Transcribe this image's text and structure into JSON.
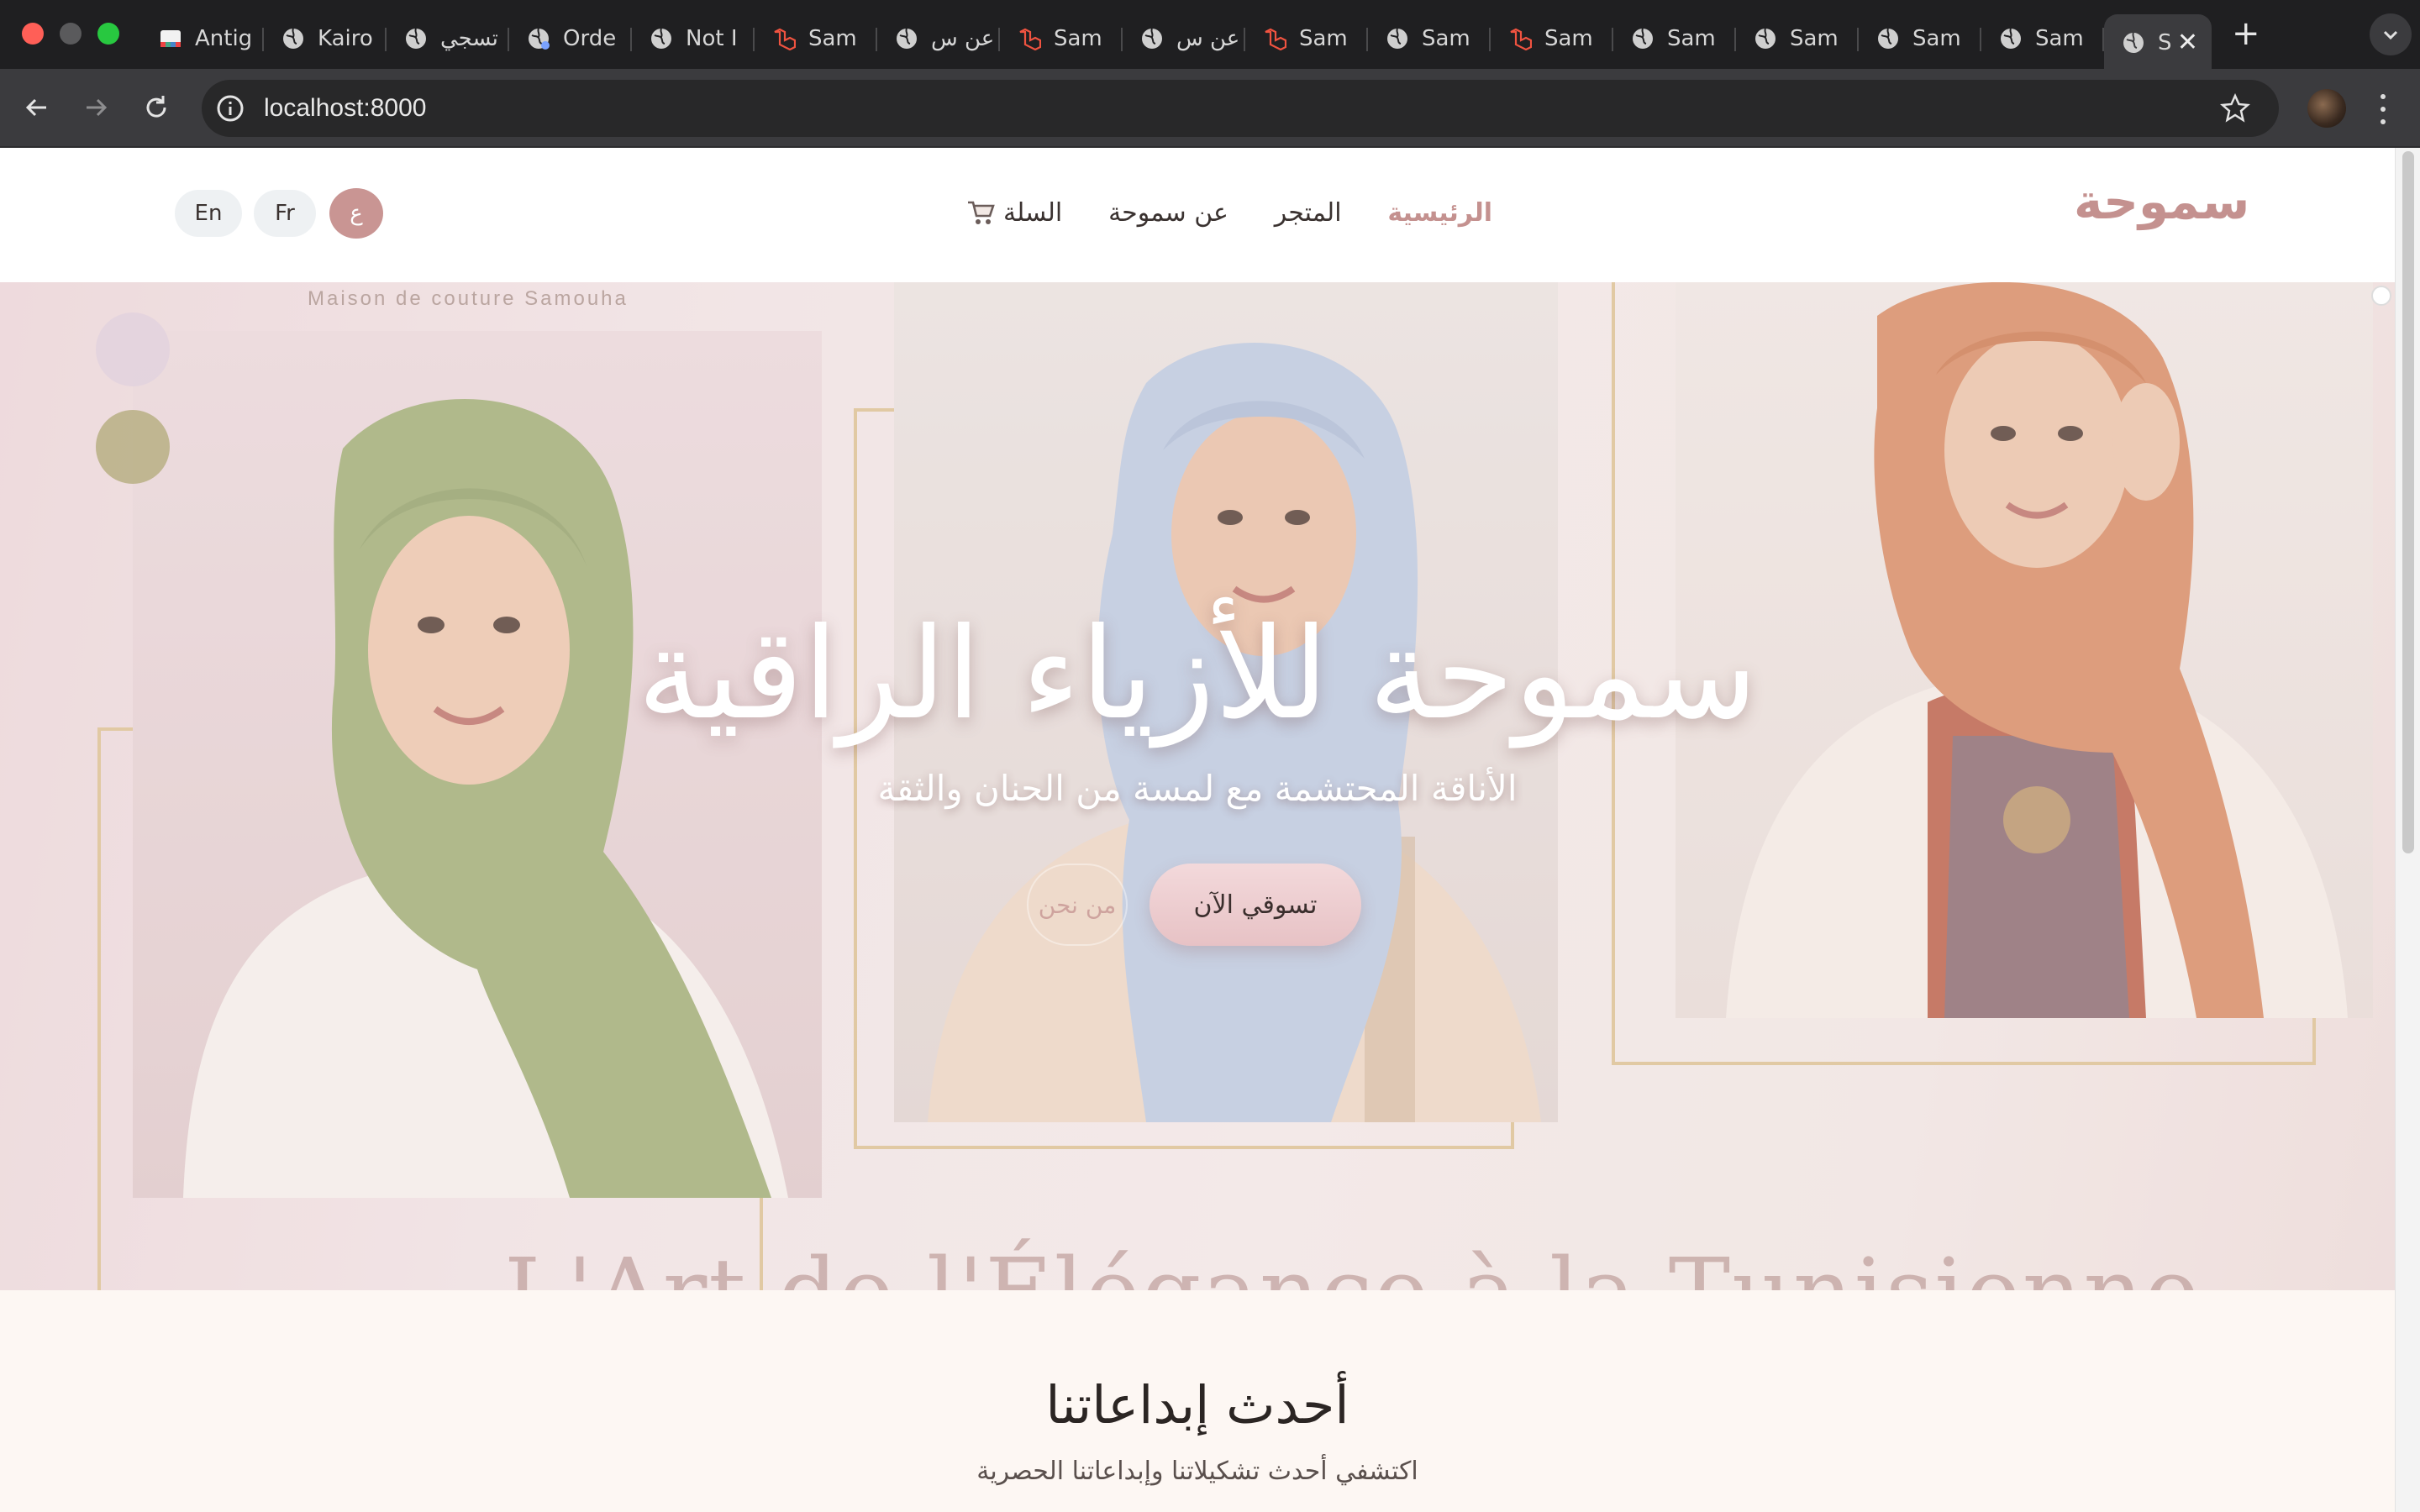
{
  "browser": {
    "tabs": [
      {
        "label": "Antig",
        "icon": "gemini-icon"
      },
      {
        "label": "Kairo",
        "icon": "globe-icon"
      },
      {
        "label": "تسجي",
        "icon": "globe-icon"
      },
      {
        "label": "Orde",
        "icon": "globe-icon"
      },
      {
        "label": "Not I",
        "icon": "globe-icon"
      },
      {
        "label": "Sam",
        "icon": "laravel-icon"
      },
      {
        "label": "عن س",
        "icon": "globe-icon"
      },
      {
        "label": "Sam",
        "icon": "laravel-icon"
      },
      {
        "label": "عن س",
        "icon": "globe-icon"
      },
      {
        "label": "Sam",
        "icon": "laravel-icon"
      },
      {
        "label": "Sam",
        "icon": "globe-icon"
      },
      {
        "label": "Sam",
        "icon": "laravel-icon"
      },
      {
        "label": "Sam",
        "icon": "globe-icon"
      },
      {
        "label": "Sam",
        "icon": "globe-icon"
      },
      {
        "label": "Sam",
        "icon": "globe-icon"
      },
      {
        "label": "Sam",
        "icon": "globe-icon"
      },
      {
        "label": "S",
        "icon": "globe-icon",
        "active": true
      }
    ],
    "close_glyph": "✕",
    "new_tab_glyph": "+",
    "address": "localhost:8000"
  },
  "site": {
    "logo": "سموحة",
    "nav": {
      "home": "الرئيسية",
      "shop": "المتجر",
      "about": "عن سموحة",
      "cart": "السلة",
      "cart_icon": "cart-icon"
    },
    "languages": {
      "ar": "ع",
      "fr": "Fr",
      "en": "En"
    },
    "colors": {
      "accent": "#c4918f",
      "lang_active": "#c99593",
      "hero_gold": "#d9bd8c"
    }
  },
  "hero": {
    "tagline": "Maison de couture Samouha",
    "title": "سموحة للأزياء الراقية",
    "subtitle": "الأناقة المحتشمة مع لمسة من الحنان والثقة",
    "shop_button": "تسوقي الآن",
    "about_button": "من نحن",
    "marquee": "L'Art de l'Élégance à la Tunisienne"
  },
  "latest": {
    "title": "أحدث إبداعاتنا",
    "subtitle": "اكتشفي أحدث تشكيلاتنا وإبداعاتنا الحصرية"
  }
}
